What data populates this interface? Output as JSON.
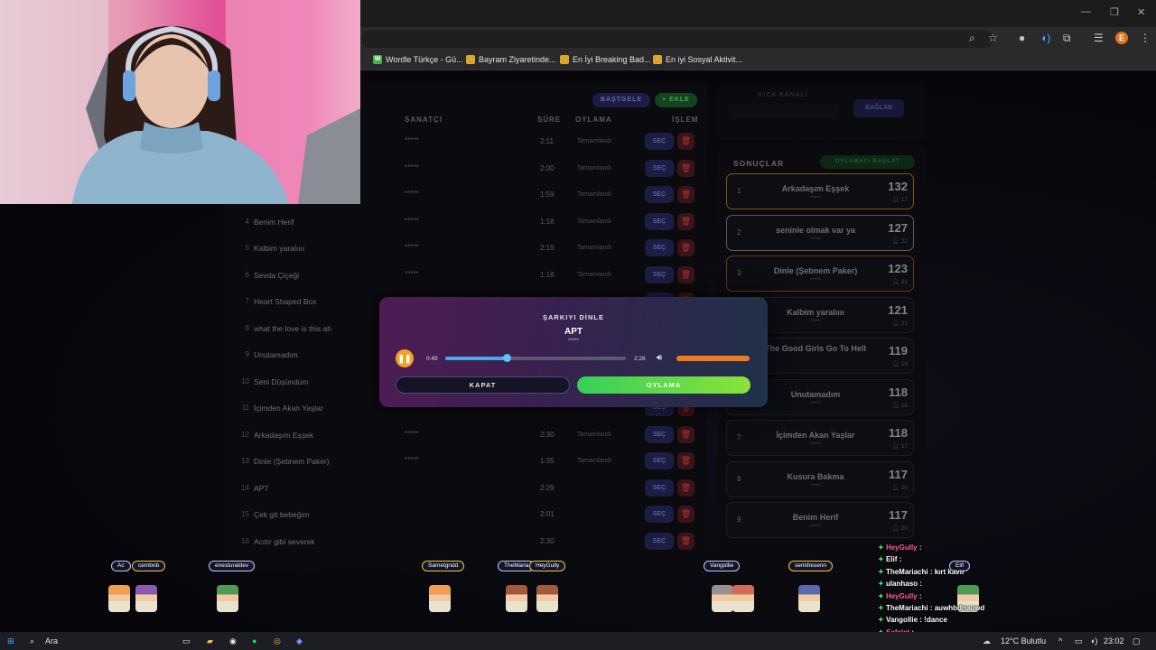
{
  "browser": {
    "bookmarks": [
      {
        "label": "Wordle Türkçe - Gü...",
        "fav": "W",
        "color": "#4caf50"
      },
      {
        "label": "Bayram Ziyaretinde...",
        "fav": "",
        "color": "#d9a72c"
      },
      {
        "label": "En İyi Breaking Bad...",
        "fav": "",
        "color": "#d9a72c"
      },
      {
        "label": "En iyi Sosyal Aktivit...",
        "fav": "",
        "color": "#d9a72c"
      }
    ],
    "profile_letter": "E"
  },
  "panel": {
    "btn_dim": "BAŞTGELE",
    "btn_green": "+ EKLE",
    "headers": {
      "artist": "SANATÇI",
      "duration": "SÜRE",
      "vote": "OYLAMA",
      "action": "İŞLEM"
    }
  },
  "rows": [
    {
      "num": "",
      "title": "",
      "artist": "*****",
      "dur": "2:11",
      "status": "Tamamlandı"
    },
    {
      "num": "",
      "title": "",
      "artist": "*****",
      "dur": "2:00",
      "status": "Tamamlandı"
    },
    {
      "num": "",
      "title": "",
      "artist": "*****",
      "dur": "1:59",
      "status": "Tamamlandı"
    },
    {
      "num": "4",
      "title": "Benim Herif",
      "artist": "*****",
      "dur": "1:18",
      "status": "Tamamlandı"
    },
    {
      "num": "5",
      "title": "Kalbim yaralıııı",
      "artist": "*****",
      "dur": "2:19",
      "status": "Tamamlandı"
    },
    {
      "num": "6",
      "title": "Sevda Çiçeği",
      "artist": "*****",
      "dur": "1:18",
      "status": "Tamamlandı"
    },
    {
      "num": "7",
      "title": "Heart Shaped Box",
      "artist": "",
      "dur": "",
      "status": ""
    },
    {
      "num": "8",
      "title": "what the love is this ah",
      "artist": "",
      "dur": "",
      "status": ""
    },
    {
      "num": "9",
      "title": "Unutamadım",
      "artist": "",
      "dur": "",
      "status": ""
    },
    {
      "num": "10",
      "title": "Seni Düşündüm",
      "artist": "",
      "dur": "",
      "status": ""
    },
    {
      "num": "11",
      "title": "İçimden Akan Yaşlar",
      "artist": "",
      "dur": "",
      "status": ""
    },
    {
      "num": "12",
      "title": "Arkadaşım Eşşek",
      "artist": "*****",
      "dur": "2:30",
      "status": "Tamamlandı"
    },
    {
      "num": "13",
      "title": "Dinle (Şebnem Paker)",
      "artist": "*****",
      "dur": "1:35",
      "status": "Tamamlandı"
    },
    {
      "num": "14",
      "title": "APT",
      "artist": "",
      "dur": "2:29",
      "status": ""
    },
    {
      "num": "15",
      "title": "Çek git bebeğim",
      "artist": "",
      "dur": "2:01",
      "status": ""
    },
    {
      "num": "16",
      "title": "Acıtır gibi severek",
      "artist": "",
      "dur": "2:30",
      "status": ""
    }
  ],
  "row_button_label": "SEÇ",
  "side": {
    "kick_label": "KICK KANALI",
    "connect_label": "BAĞLAN",
    "results_label": "SONUÇLAR",
    "results_btn": "OYLAMAYI BAŞLAT"
  },
  "results": [
    {
      "rank": "1",
      "title": "Arkadaşım Eşşek",
      "votes": "132",
      "voters": "17",
      "tier": "gold"
    },
    {
      "rank": "2",
      "title": "seninle olmak var ya",
      "votes": "127",
      "voters": "22",
      "tier": "silver"
    },
    {
      "rank": "3",
      "title": "Dinle (Şebnem Paker)",
      "votes": "123",
      "voters": "21",
      "tier": "bronze"
    },
    {
      "rank": "",
      "title": "Kalbim yaralıııı",
      "votes": "121",
      "voters": "21",
      "tier": ""
    },
    {
      "rank": "",
      "title": "The Good Girls Go To Hell",
      "votes": "119",
      "voters": "19",
      "tier": ""
    },
    {
      "rank": "",
      "title": "Unutamadım",
      "votes": "118",
      "voters": "18",
      "tier": ""
    },
    {
      "rank": "7",
      "title": "İçimden Akan Yaşlar",
      "votes": "118",
      "voters": "17",
      "tier": ""
    },
    {
      "rank": "8",
      "title": "Kusura Bakma",
      "votes": "117",
      "voters": "20",
      "tier": ""
    },
    {
      "rank": "9",
      "title": "Benim Herif",
      "votes": "117",
      "voters": "20",
      "tier": ""
    }
  ],
  "result_stars": "*****",
  "modal": {
    "heading": "ŞARKIYI DİNLE",
    "song": "APT",
    "artist": "*****",
    "current": "0:49",
    "total": "2:28",
    "progress": 0.34,
    "volume": 1.0,
    "close_label": "KAPAT",
    "vote_label": "OYLAMA"
  },
  "overlay": {
    "names": [
      {
        "label": "Ac",
        "x": 0,
        "gold": false
      },
      {
        "label": "cembnb",
        "gold": true
      },
      {
        "label": "enesturaldev",
        "gold": false
      },
      {
        "label": "Sametgndd",
        "gold": true
      },
      {
        "label": "TheMaria",
        "gold": false
      },
      {
        "label": "HeyGully",
        "gold": true
      },
      {
        "label": "Vangollie",
        "gold": false
      },
      {
        "label": "semihesenn",
        "gold": true
      },
      {
        "label": "Elif",
        "gold": false
      }
    ],
    "chat": [
      {
        "user": "HeyGully",
        "color": "#ff5fa0",
        "msg": ""
      },
      {
        "user": "Elif",
        "color": "#ffffff",
        "msg": ""
      },
      {
        "user": "TheMariachi",
        "color": "#ffffff",
        "msg": "kırt kavır"
      },
      {
        "user": "ulanhaso",
        "color": "#ffffff",
        "msg": ""
      },
      {
        "user": "HeyGully",
        "color": "#ff5fa0",
        "msg": ""
      },
      {
        "user": "TheMariachi",
        "color": "#ffffff",
        "msg": "auwhbdnauwd"
      },
      {
        "user": "Vangollie",
        "color": "#ffffff",
        "msg": "!dance"
      },
      {
        "user": "Sefalet",
        "color": "#ff5fa0",
        "msg": ""
      }
    ]
  },
  "taskbar": {
    "search": "Ara",
    "weather": "12°C  Bulutlu",
    "time": "23:02"
  }
}
